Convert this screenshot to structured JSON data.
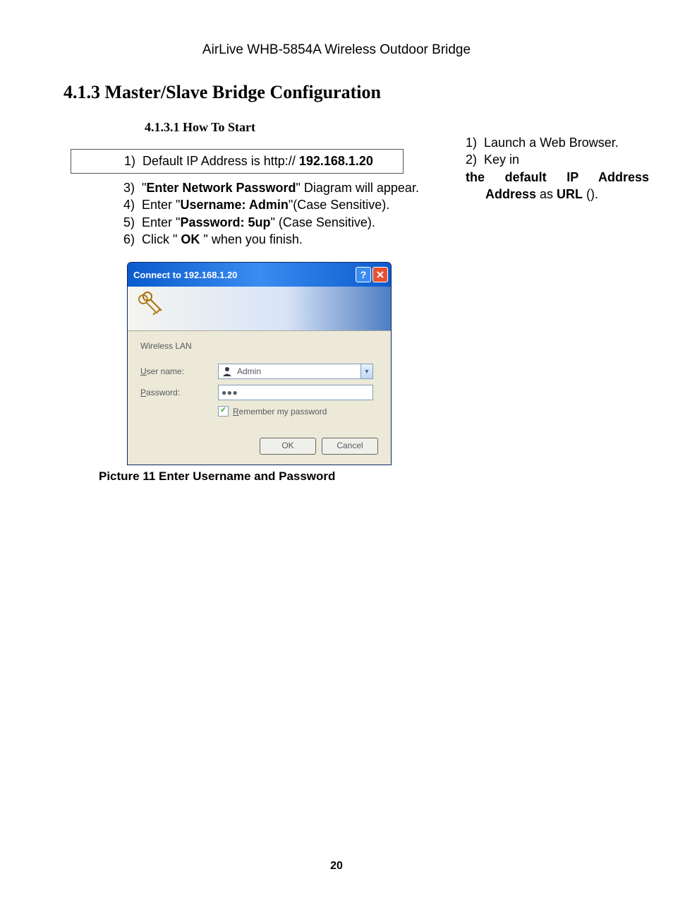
{
  "header": "AirLive WHB-5854A Wireless Outdoor Bridge",
  "section_heading": "4.1.3 Master/Slave Bridge Configuration",
  "subsection": "4.1.3.1 How To Start",
  "right": {
    "item1_n": "1)",
    "item1_t": "Launch a Web Browser.",
    "item2_n": "2)",
    "item2_t": "Key in ",
    "item2_bold": "the default IP Address",
    "item2_as": " as ",
    "item2_url": "URL",
    "item2_paren": " ()."
  },
  "boxed_n": "1)",
  "boxed_pre": "Default IP Address is http:// ",
  "boxed_ip": "192.168.1.20",
  "list": {
    "l3_n": "3)",
    "l3_q1": "\"",
    "l3_b": "Enter Network Password",
    "l3_post": "\" Diagram will appear.",
    "l4_n": "4)",
    "l4_pre1": "Enter \"",
    "l4_b": "Username: Admin",
    "l4_post": "\"(Case Sensitive).",
    "l5_n": "5)",
    "l5_pre1": "Enter \"",
    "l5_b": "Password: 5up",
    "l5_post": "\" (Case Sensitive).",
    "l6_n": "6)",
    "l6_pre": "Click \" ",
    "l6_b": "OK",
    "l6_post": " \" when you finish."
  },
  "dialog": {
    "title": "Connect to 192.168.1.20",
    "realm": "Wireless LAN",
    "username_label_pre": "U",
    "username_label_post": "ser name:",
    "username_value": "Admin",
    "password_label_pre": "P",
    "password_label_post": "assword:",
    "password_mask": "●●●",
    "remember_pre": "R",
    "remember_post": "emember my password",
    "ok": "OK",
    "cancel": "Cancel"
  },
  "caption": "Picture 11 Enter Username and Password",
  "page_number": "20"
}
